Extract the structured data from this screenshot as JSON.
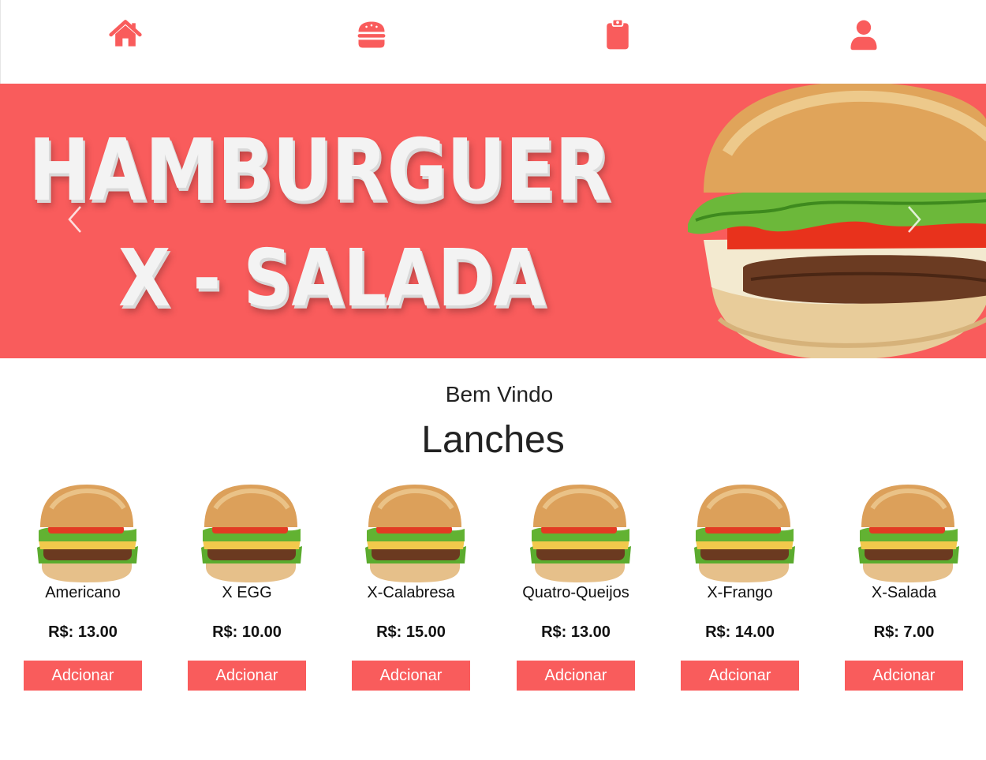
{
  "colors": {
    "accent": "#f95c5c",
    "text": "#222222",
    "white": "#ffffff"
  },
  "nav": {
    "items": [
      {
        "icon": "home-icon"
      },
      {
        "icon": "hamburger-icon"
      },
      {
        "icon": "clipboard-icon"
      },
      {
        "icon": "user-icon"
      }
    ]
  },
  "banner": {
    "line1": "HAMBURGUER",
    "line2": "X - SALADA",
    "prev_icon": "chevron-left-icon",
    "next_icon": "chevron-right-icon"
  },
  "main": {
    "welcome": "Bem Vindo",
    "section_title": "Lanches",
    "products": [
      {
        "name": "Americano",
        "price": "R$: 13.00",
        "button": "Adcionar"
      },
      {
        "name": "X EGG",
        "price": "R$: 10.00",
        "button": "Adcionar"
      },
      {
        "name": "X-Calabresa",
        "price": "R$: 15.00",
        "button": "Adcionar"
      },
      {
        "name": "Quatro-Queijos",
        "price": "R$: 13.00",
        "button": "Adcionar"
      },
      {
        "name": "X-Frango",
        "price": "R$: 14.00",
        "button": "Adcionar"
      },
      {
        "name": "X-Salada",
        "price": "R$: 7.00",
        "button": "Adcionar"
      }
    ]
  }
}
